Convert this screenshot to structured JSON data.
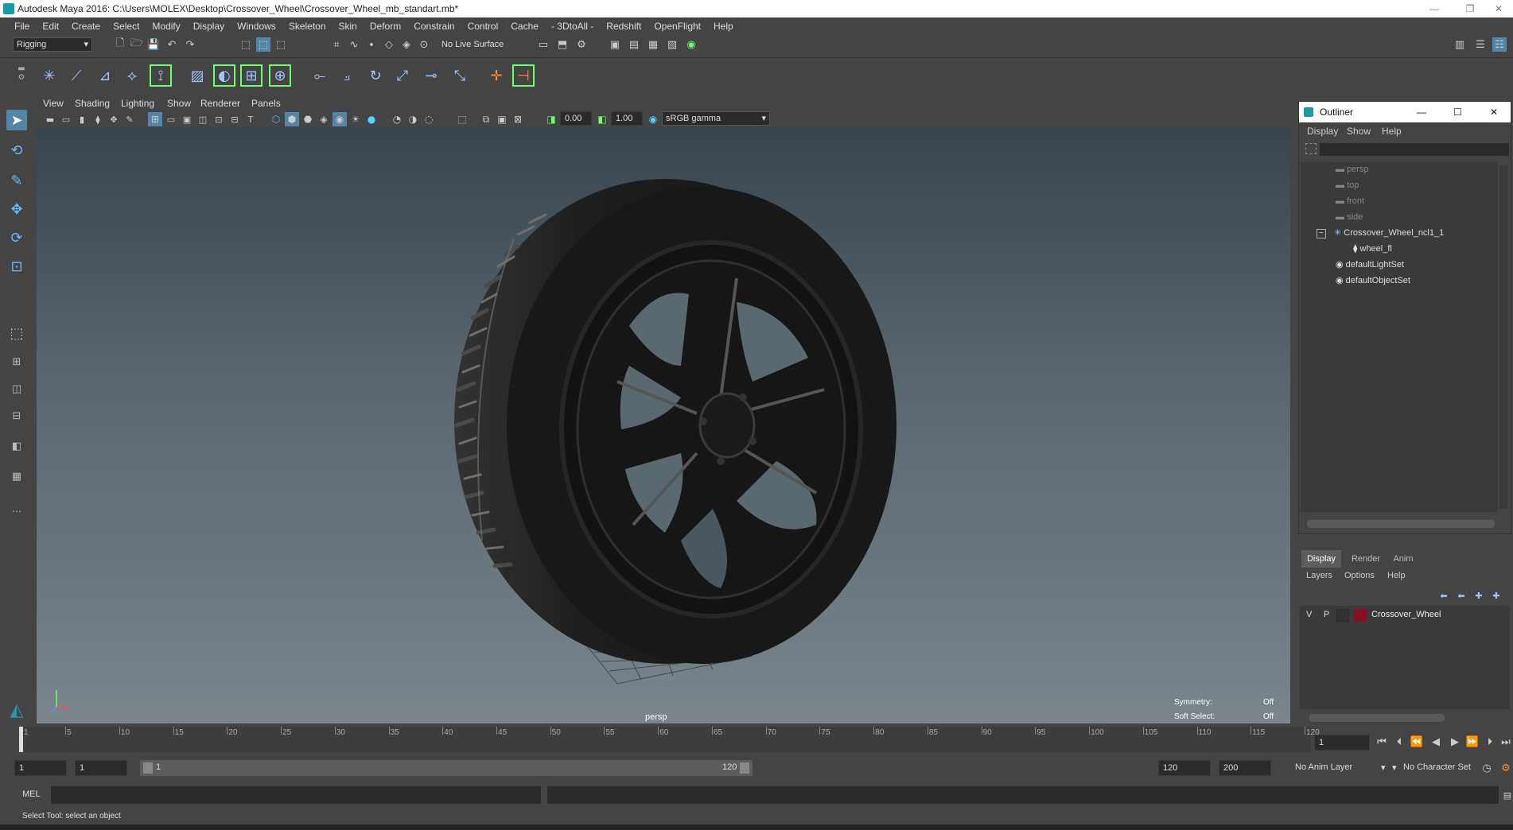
{
  "window": {
    "title": "Autodesk Maya 2016: C:\\Users\\MOLEX\\Desktop\\Crossover_Wheel\\Crossover_Wheel_mb_standart.mb*",
    "minimize": "—",
    "restore": "❐",
    "close": "✕"
  },
  "menubar": [
    "File",
    "Edit",
    "Create",
    "Select",
    "Modify",
    "Display",
    "Windows",
    "Skeleton",
    "Skin",
    "Deform",
    "Constrain",
    "Control",
    "Cache",
    "- 3DtoAll -",
    "Redshift",
    "OpenFlight",
    "Help"
  ],
  "status_line": {
    "menuset": "Rigging",
    "live_surface": "No Live Surface"
  },
  "viewport": {
    "menus": [
      "View",
      "Shading",
      "Lighting",
      "Show",
      "Renderer",
      "Panels"
    ],
    "exposure": "0.00",
    "gamma": "1.00",
    "color_space": "sRGB gamma",
    "camera_label": "persp",
    "symmetry_label": "Symmetry:",
    "symmetry_value": "Off",
    "soft_select_label": "Soft Select:",
    "soft_select_value": "Off"
  },
  "outliner": {
    "title": "Outliner",
    "menus": [
      "Display",
      "Show",
      "Help"
    ],
    "items": [
      {
        "label": "persp",
        "dim": true
      },
      {
        "label": "top",
        "dim": true
      },
      {
        "label": "front",
        "dim": true
      },
      {
        "label": "side",
        "dim": true
      },
      {
        "label": "Crossover_Wheel_ncl1_1",
        "dim": false
      },
      {
        "label": "wheel_fl",
        "dim": false
      },
      {
        "label": "defaultLightSet",
        "dim": false
      },
      {
        "label": "defaultObjectSet",
        "dim": false
      }
    ]
  },
  "layer_editor": {
    "tabs": [
      "Display",
      "Render",
      "Anim"
    ],
    "menus": [
      "Layers",
      "Options",
      "Help"
    ],
    "layer": {
      "v": "V",
      "p": "P",
      "name": "Crossover_Wheel",
      "color": "#8b0f22"
    }
  },
  "timeline": {
    "ticks": [
      "1",
      "5",
      "10",
      "15",
      "20",
      "25",
      "30",
      "35",
      "40",
      "45",
      "50",
      "55",
      "60",
      "65",
      "70",
      "75",
      "80",
      "85",
      "90",
      "95",
      "100",
      "105",
      "110",
      "115",
      "120"
    ],
    "current_frame": "1"
  },
  "range": {
    "start": "1",
    "playback_start": "1",
    "slider_start": "1",
    "slider_end": "120",
    "playback_end": "120",
    "end": "200",
    "anim_layer": "No Anim Layer",
    "char_set": "No Character Set"
  },
  "command": {
    "lang": "MEL"
  },
  "help_line": "Select Tool: select an object",
  "colors": {
    "accent": "#5285a6",
    "layer_red": "#8b0f22",
    "ui_bg": "#444444"
  }
}
